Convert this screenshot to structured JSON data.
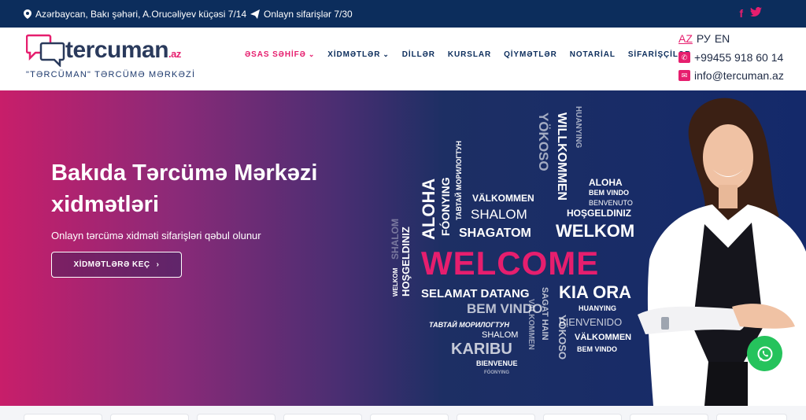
{
  "topbar": {
    "address": "Azərbaycan, Bakı şəhəri, A.Orucəliyev küçəsi 7/14",
    "online_orders": "Onlayn sifarişlər 7/30",
    "social": [
      "facebook-icon",
      "twitter-icon"
    ]
  },
  "logo": {
    "name": "tercuman",
    "domain": ".az",
    "subtitle": "\"TƏRCÜMAN\" TƏRCÜMƏ MƏRKƏZİ"
  },
  "nav": {
    "items": [
      {
        "label": "ƏSAS SƏHİFƏ",
        "dropdown": true,
        "active": true
      },
      {
        "label": "XİDMƏTLƏR",
        "dropdown": true,
        "active": false
      },
      {
        "label": "DİLLƏR",
        "dropdown": false,
        "active": false
      },
      {
        "label": "KURSLAR",
        "dropdown": false,
        "active": false
      },
      {
        "label": "QİYMƏTLƏR",
        "dropdown": false,
        "active": false
      },
      {
        "label": "NOTARİAL",
        "dropdown": false,
        "active": false
      },
      {
        "label": "SİFARİŞÇİLƏR",
        "dropdown": false,
        "active": false
      }
    ]
  },
  "languages": {
    "current": "AZ",
    "others": [
      "РУ",
      "EN"
    ]
  },
  "contact": {
    "phone": "+99455 918 60 14",
    "email": "info@tercuman.az"
  },
  "hero": {
    "title": "Bakıda Tərcümə Mərkəzi xidmətləri",
    "subtitle": "Onlayn tərcümə xidməti sifarişləri qəbul olunur",
    "button": "XİDMƏTLƏRƏ KEÇ"
  },
  "word_cloud": {
    "welcome": "WELCOME",
    "words": [
      "ALOHA",
      "FÓONYING",
      "ТАВТАЙ МОРИЛОГТУН",
      "VÄLKOMMEN",
      "SHALOM",
      "SHAGATOM",
      "WELKOM",
      "YÖKOSO",
      "WILLKOMMEN",
      "HUANYING",
      "ALOHA",
      "BEM VINDO",
      "BENVENUTO",
      "HOŞGELDINIZ",
      "SELAMAT DATANG",
      "KIA ORA",
      "BEM VINDO",
      "ТАВТАЙ МОРИЛОГТУН",
      "SHALOM",
      "KARIBU",
      "BIENVENUE",
      "SHALOM",
      "HOŞGELDINIZ",
      "WELKOM",
      "SAGAT HAIN",
      "VALKOMMEN",
      "YÖKOSO",
      "HUANYING",
      "BIENVENIDO",
      "VÄLKOMMEN",
      "BEM VINDO",
      "FÓONYING"
    ]
  },
  "colors": {
    "accent": "#e61e6e",
    "navy": "#0c2d5c",
    "whatsapp": "#25c35c"
  }
}
